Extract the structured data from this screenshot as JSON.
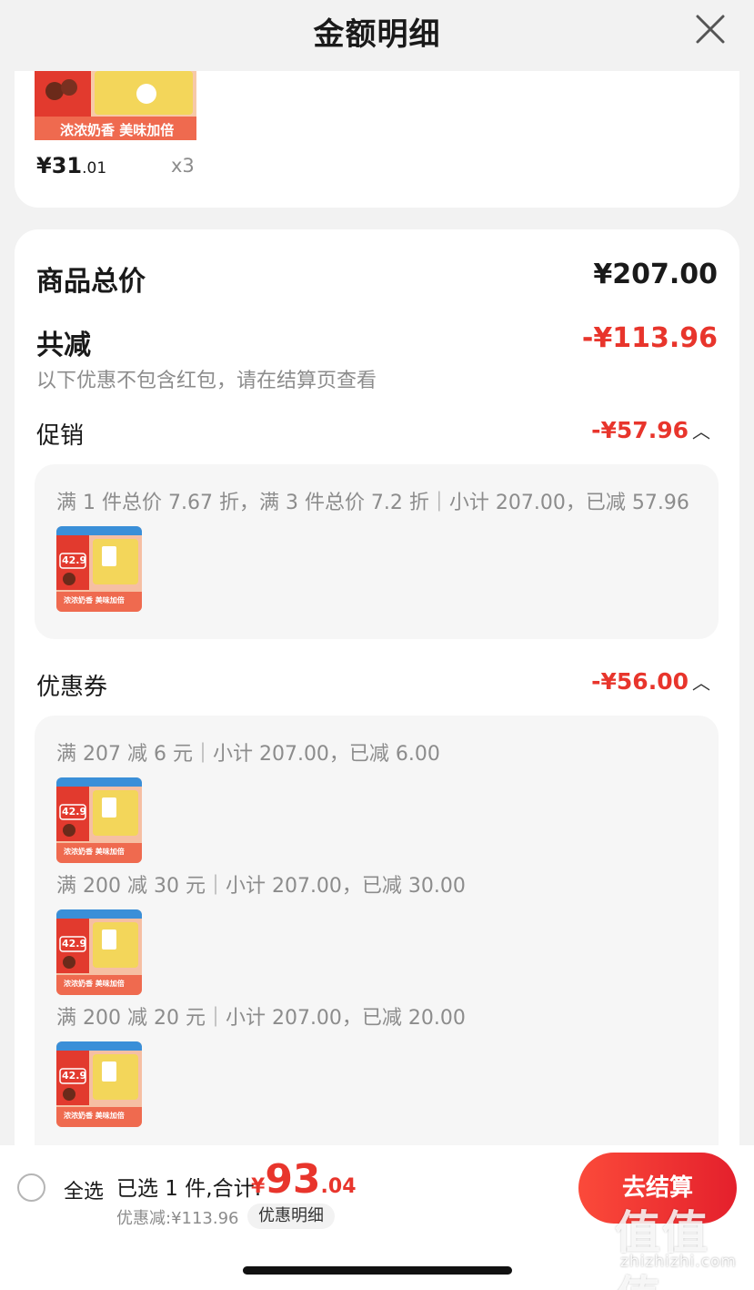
{
  "header": {
    "title": "金额明细"
  },
  "product": {
    "price_int": "¥31",
    "price_dec": ".01",
    "quantity": "x3",
    "banner_text": "浓浓奶香 美味加倍"
  },
  "summary": {
    "total_label": "商品总价",
    "total_value": "¥207.00",
    "reduce_label": "共减",
    "reduce_value": "-¥113.96",
    "reduce_note": "以下优惠不包含红包，请在结算页查看"
  },
  "promo": {
    "label": "促销",
    "value": "-¥57.96",
    "detail": "满 1 件总价 7.67 折，满 3 件总价 7.2 折｜小计 207.00，已减 57.96"
  },
  "coupon": {
    "label": "优惠券",
    "value": "-¥56.00",
    "items": [
      {
        "text": "满 207 减 6 元｜小计 207.00，已减 6.00"
      },
      {
        "text": "满 200 减 30 元｜小计 207.00，已减 30.00"
      },
      {
        "text": "满 200 减 20 元｜小计 207.00，已减 20.00"
      }
    ]
  },
  "thumb": {
    "price_tag": "42.9",
    "banner": "浓浓奶香 美味加倍"
  },
  "bottom": {
    "select_all": "全选",
    "selected": "已选 1 件,合计:",
    "total_currency": "¥",
    "total_int": "93",
    "total_dec": ".04",
    "discount": "优惠减:¥113.96",
    "detail_chip": "优惠明细",
    "checkout": "去结算"
  },
  "watermark": {
    "text": "值值值",
    "url": "zhizhizhi.com"
  },
  "colors": {
    "accent_red": "#e8352c",
    "checkout_start": "#fb4a3a",
    "checkout_end": "#e4202c"
  }
}
